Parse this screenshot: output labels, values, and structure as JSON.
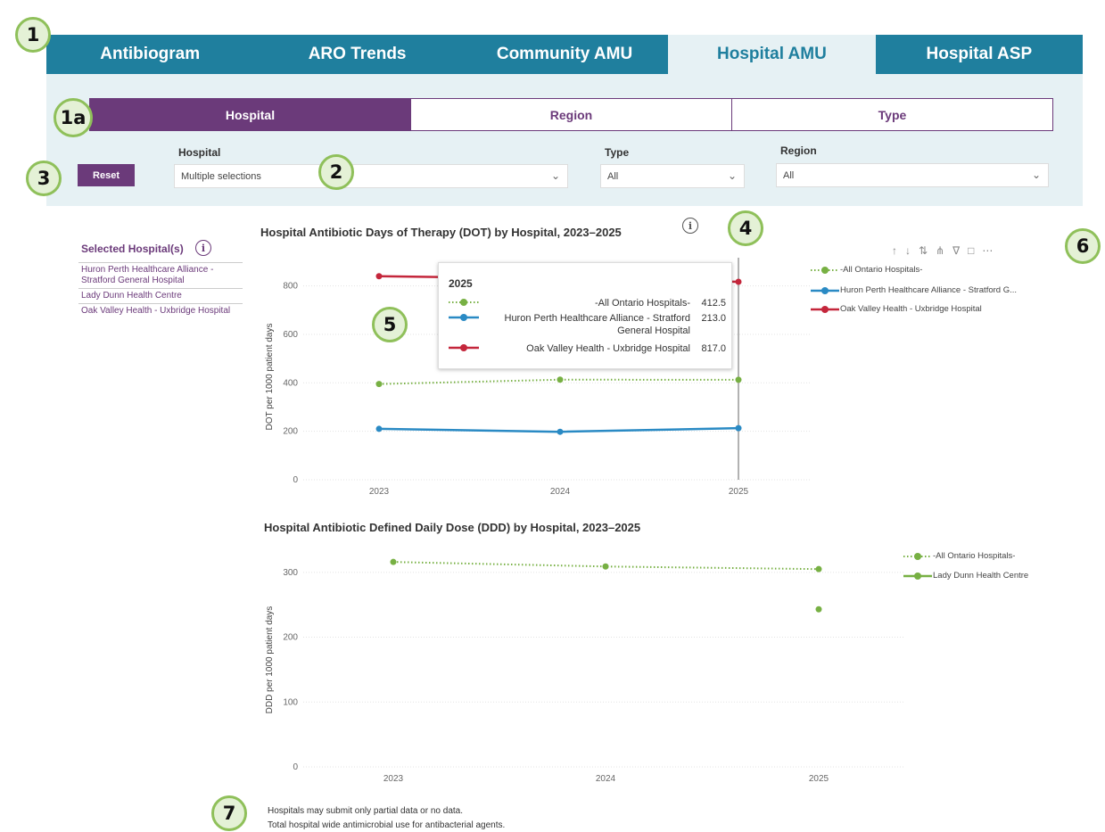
{
  "badges": [
    "1",
    "1a",
    "2",
    "3",
    "4",
    "5",
    "6",
    "7"
  ],
  "tabs": [
    {
      "label": "Antibiogram",
      "active": false
    },
    {
      "label": "ARO Trends",
      "active": false
    },
    {
      "label": "Community AMU",
      "active": false
    },
    {
      "label": "Hospital AMU",
      "active": true
    },
    {
      "label": "Hospital ASP",
      "active": false
    }
  ],
  "segments": [
    {
      "label": "Hospital",
      "active": true
    },
    {
      "label": "Region",
      "active": false
    },
    {
      "label": "Type",
      "active": false
    }
  ],
  "filters": {
    "reset_label": "Reset",
    "hospital": {
      "label": "Hospital",
      "value": "Multiple selections"
    },
    "type": {
      "label": "Type",
      "value": "All"
    },
    "region": {
      "label": "Region",
      "value": "All"
    }
  },
  "selected_panel": {
    "title": "Selected Hospital(s)",
    "items": [
      "Huron Perth Healthcare Alliance - Stratford General Hospital",
      "Lady Dunn Health Centre",
      "Oak Valley Health - Uxbridge Hospital"
    ]
  },
  "toolbar_icons": [
    "arrow-up-icon",
    "arrow-down-icon",
    "expand-level-icon",
    "drill-icon",
    "filter-icon",
    "focus-mode-icon",
    "more-options-icon"
  ],
  "colors": {
    "tab_blue": "#1f7f9e",
    "purple": "#6b3a7a",
    "series_green": "#77b043",
    "series_blue": "#2a8ac4",
    "series_red": "#c4263b"
  },
  "tooltip": {
    "title": "2025",
    "rows": [
      {
        "name": "-All Ontario Hospitals-",
        "value": "412.5"
      },
      {
        "name": "Huron Perth Healthcare Alliance - Stratford General Hospital",
        "value": "213.0"
      },
      {
        "name": "Oak Valley Health - Uxbridge Hospital",
        "value": "817.0"
      }
    ]
  },
  "chart_data": [
    {
      "type": "line",
      "title": "Hospital Antibiotic Days of Therapy (DOT) by Hospital, 2023–2025",
      "xlabel": "",
      "ylabel": "DOT per 1000 patient days",
      "x": [
        "2023",
        "2024",
        "2025"
      ],
      "ylim": [
        0,
        850
      ],
      "yticks": [
        0,
        200,
        400,
        600,
        800
      ],
      "series": [
        {
          "name": "-All Ontario Hospitals-",
          "values": [
            395,
            413,
            412.5
          ],
          "style": "dotted",
          "color": "#77b043"
        },
        {
          "name": "Huron Perth Healthcare Alliance - Stratford G...",
          "values": [
            210,
            198,
            213
          ],
          "style": "solid",
          "color": "#2a8ac4"
        },
        {
          "name": "Oak Valley Health - Uxbridge Hospital",
          "values": [
            840,
            830,
            817
          ],
          "style": "solid",
          "color": "#c4263b"
        }
      ],
      "legend": "top-right"
    },
    {
      "type": "line",
      "title": "Hospital Antibiotic Defined Daily Dose (DDD) by Hospital, 2023–2025",
      "xlabel": "",
      "ylabel": "DDD per 1000 patient days",
      "x": [
        "2023",
        "2024",
        "2025"
      ],
      "ylim": [
        0,
        330
      ],
      "yticks": [
        0,
        100,
        200,
        300
      ],
      "series": [
        {
          "name": "-All Ontario Hospitals-",
          "values": [
            316,
            309,
            305
          ],
          "style": "dotted",
          "color": "#77b043"
        },
        {
          "name": "Lady Dunn Health Centre",
          "values": [
            null,
            null,
            243
          ],
          "style": "solid",
          "color": "#77b043"
        }
      ],
      "legend": "top-right"
    }
  ],
  "footnotes": [
    "Hospitals may submit only partial data or no data.",
    "Total hospital wide antimicrobial use for antibacterial agents."
  ]
}
